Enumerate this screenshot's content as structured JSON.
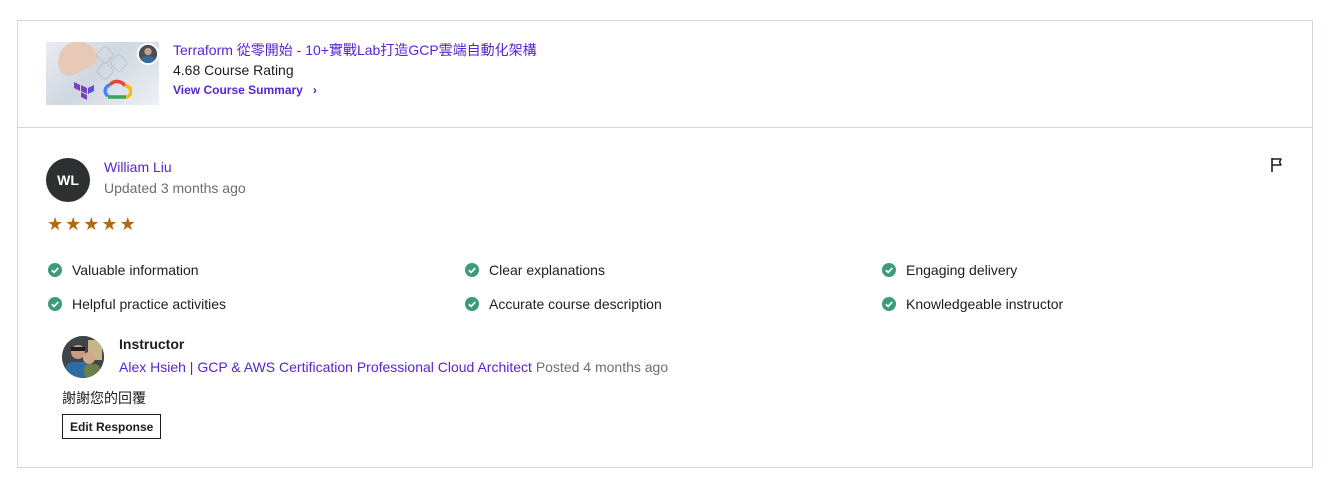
{
  "course": {
    "title": "Terraform 從零開始 - 10+實戰Lab打造GCP雲端自動化架構",
    "rating": "4.68 Course Rating",
    "summary_link": "View Course Summary",
    "summary_chevron": "›"
  },
  "review": {
    "avatar_initials": "WL",
    "reviewer_name": "William Liu",
    "updated": "Updated 3 months ago",
    "stars": [
      "★",
      "★",
      "★",
      "★",
      "★"
    ],
    "rating": 5,
    "star_color": "#b4690e",
    "flag_icon": "flag-icon",
    "feedback": [
      "Valuable information",
      "Clear explanations",
      "Engaging delivery",
      "Helpful practice activities",
      "Accurate course description",
      "Knowledgeable instructor"
    ],
    "check_color": "#3d9a7c"
  },
  "instructor_response": {
    "label": "Instructor",
    "name": "Alex Hsieh | GCP & AWS Certification Professional Cloud Architect",
    "posted": "Posted 4 months ago",
    "reply": "謝謝您的回覆",
    "edit_button": "Edit Response"
  },
  "colors": {
    "link": "#5624d0",
    "muted": "#6a6f73",
    "border": "#d1d7dc",
    "avatar_bg": "#2d2f31"
  }
}
